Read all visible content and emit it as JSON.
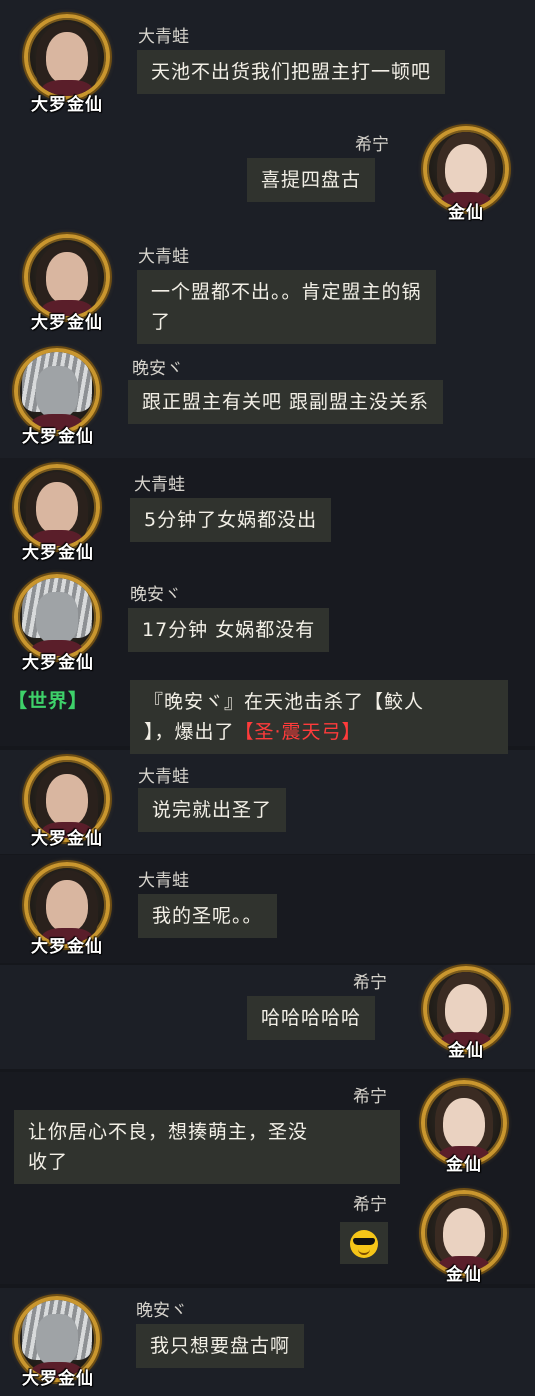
{
  "messages": [
    {
      "sender": "大青蛙",
      "rank": "大罗金仙",
      "avatar": "frog-avatar",
      "text": "天池不出货我们把盟主打一顿吧"
    },
    {
      "sender": "希宁",
      "rank": "金仙",
      "avatar": "xining-avatar",
      "text": "喜提四盘古"
    },
    {
      "sender": "大青蛙",
      "rank": "大罗金仙",
      "avatar": "frog-avatar",
      "text_line1": "一个盟都不出。。肯定盟主的锅",
      "text_line2": "了"
    },
    {
      "sender": "晚安ヾ",
      "rank": "大罗金仙",
      "avatar": "wanan-avatar",
      "text": "跟正盟主有关吧 跟副盟主没关系"
    },
    {
      "sender": "大青蛙",
      "rank": "大罗金仙",
      "avatar": "frog-avatar",
      "text": "5分钟了女娲都没出"
    },
    {
      "sender": "晚安ヾ",
      "rank": "大罗金仙",
      "avatar": "wanan-avatar",
      "text": "17分钟 女娲都没有"
    },
    {
      "sender": "大青蛙",
      "rank": "大罗金仙",
      "avatar": "frog-avatar",
      "text": "说完就出圣了"
    },
    {
      "sender": "大青蛙",
      "rank": "大罗金仙",
      "avatar": "frog-avatar",
      "text": "我的圣呢。。"
    },
    {
      "sender": "希宁",
      "rank": "金仙",
      "avatar": "xining-avatar",
      "text": "哈哈哈哈哈"
    },
    {
      "sender": "希宁",
      "rank": "金仙",
      "avatar": "xining-avatar",
      "text_line1": "让你居心不良，想揍萌主，圣没",
      "text_line2": "收了"
    },
    {
      "sender": "希宁",
      "rank": "金仙",
      "avatar": "xining-avatar",
      "emoji": "sunglasses-emoji"
    },
    {
      "sender": "晚安ヾ",
      "rank": "大罗金仙",
      "avatar": "wanan-avatar",
      "text": "我只想要盘古啊"
    }
  ],
  "system": {
    "tag": "【世界】",
    "line1": "『晚安ヾ』在天池击杀了【鲛人",
    "line2_a": "】，爆出了",
    "line2_item": "【圣·震天弓】"
  }
}
